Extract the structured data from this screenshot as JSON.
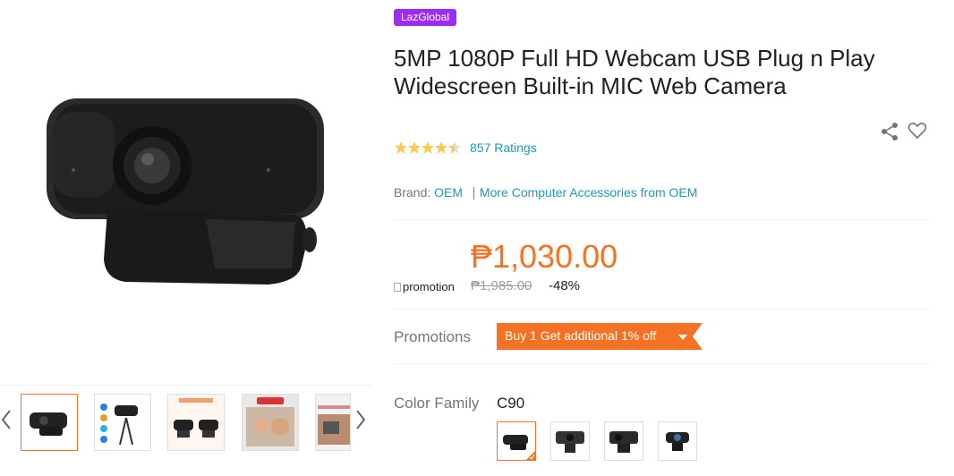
{
  "badge": {
    "text": "LazGlobal",
    "color": "#9d2cf5"
  },
  "product": {
    "title_line1": "5MP 1080P Full HD Webcam USB Plug n Play",
    "title_line2": "Widescreen Built-in MIC Web Camera",
    "rating": 4.5,
    "ratings_count": "857 Ratings",
    "brand_label": "Brand:",
    "brand_name": "OEM",
    "more_from": "More Computer Accessories from OEM"
  },
  "price": {
    "current": "₱1,030.00",
    "original": "₱1,985.00",
    "discount": "-48%",
    "promotion_alt": "promotion"
  },
  "promotions": {
    "label": "Promotions",
    "tag_text": "Buy 1 Get additional 1% off",
    "tag_color": "#f57224"
  },
  "color_family": {
    "label": "Color Family",
    "selected": "C90",
    "options_count": 4
  },
  "gallery": {
    "thumbnails": [
      "webcam",
      "product-infographic",
      "removable-cover",
      "family-video-call",
      "living-room"
    ],
    "active_index": 0
  },
  "icons": {
    "share": "share-icon",
    "wishlist": "heart-icon",
    "prev": "chevron-left-icon",
    "next": "chevron-right-icon"
  },
  "colors": {
    "accent": "#f57224",
    "link": "#1a9cb7",
    "star": "#faca51"
  }
}
